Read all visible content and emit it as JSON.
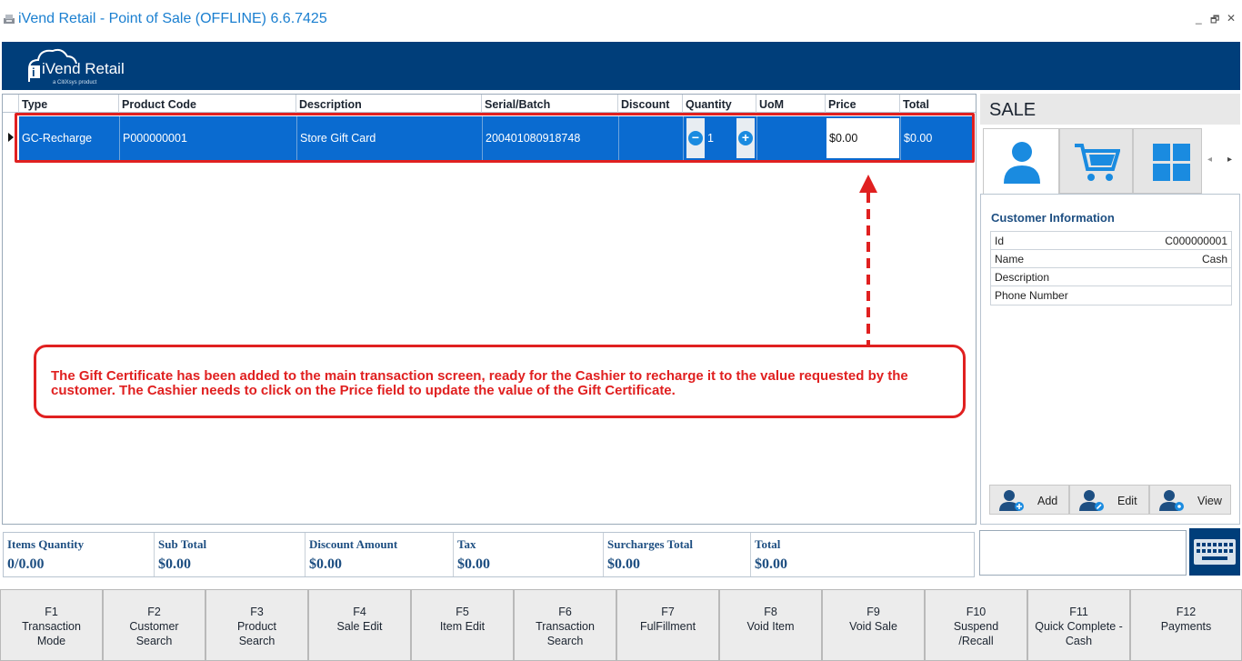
{
  "window": {
    "title": "iVend Retail - Point of Sale (OFFLINE) 6.6.7425",
    "minimize_glyph": "_",
    "restore_glyph": "🗗",
    "close_glyph": "✕"
  },
  "header": {
    "logo_text": "iVend Retail",
    "logo_sub": "a CitiXsys product",
    "logo_glyph": "i"
  },
  "grid": {
    "columns": [
      "Type",
      "Product Code",
      "Description",
      "Serial/Batch",
      "Discount",
      "Quantity",
      "UoM",
      "Price",
      "Total"
    ],
    "rows": [
      {
        "type": "GC-Recharge",
        "product_code": "P000000001",
        "description": "Store Gift Card",
        "serial_batch": "200401080918748",
        "discount": "",
        "quantity": "1",
        "uom": "",
        "price": "$0.00",
        "total": "$0.00"
      }
    ],
    "qty_minus": "−",
    "qty_plus": "+"
  },
  "annotation": {
    "text": "The Gift Certificate has been added to the main transaction screen, ready for the Cashier to recharge it to the value requested by the customer. The Cashier needs to click on the Price field to update the value of the Gift Certificate.",
    "color": "#e02020"
  },
  "sale_panel": {
    "title": "SALE",
    "tabs": [
      {
        "icon": "customer-icon",
        "active": true
      },
      {
        "icon": "cart-icon",
        "active": false
      },
      {
        "icon": "tiles-icon",
        "active": false
      }
    ],
    "nav_prev": "◂",
    "nav_next": "▸",
    "customer_info_title": "Customer Information",
    "fields": [
      {
        "label": "Id",
        "value": "C000000001"
      },
      {
        "label": "Name",
        "value": "Cash"
      },
      {
        "label": "Description",
        "value": ""
      },
      {
        "label": "Phone Number",
        "value": ""
      }
    ],
    "actions": [
      {
        "label": "Add",
        "icon": "add-customer-icon"
      },
      {
        "label": "Edit",
        "icon": "edit-customer-icon"
      },
      {
        "label": "View",
        "icon": "view-customer-icon"
      }
    ]
  },
  "totals": [
    {
      "label": "Items Quantity",
      "value": "0/0.00"
    },
    {
      "label": "Sub Total",
      "value": "$0.00"
    },
    {
      "label": "Discount Amount",
      "value": "$0.00"
    },
    {
      "label": "Tax",
      "value": "$0.00"
    },
    {
      "label": "Surcharges Total",
      "value": "$0.00"
    },
    {
      "label": "Total",
      "value": "$0.00"
    }
  ],
  "function_keys": [
    {
      "key": "F1",
      "label": "Transaction\nMode"
    },
    {
      "key": "F2",
      "label": "Customer\nSearch"
    },
    {
      "key": "F3",
      "label": "Product\nSearch"
    },
    {
      "key": "F4",
      "label": "Sale Edit"
    },
    {
      "key": "F5",
      "label": "Item Edit"
    },
    {
      "key": "F6",
      "label": "Transaction\nSearch"
    },
    {
      "key": "F7",
      "label": "FulFillment"
    },
    {
      "key": "F8",
      "label": "Void Item"
    },
    {
      "key": "F9",
      "label": "Void Sale"
    },
    {
      "key": "F10",
      "label": "Suspend\n/Recall"
    },
    {
      "key": "F11",
      "label": "Quick Complete -\nCash"
    },
    {
      "key": "F12",
      "label": "Payments"
    }
  ],
  "colors": {
    "brand_navy": "#003e7a",
    "title_blue": "#1a7fd0",
    "selection_blue": "#0a6bd0",
    "icon_blue": "#1a8be0",
    "label_blue": "#1e4f82"
  }
}
